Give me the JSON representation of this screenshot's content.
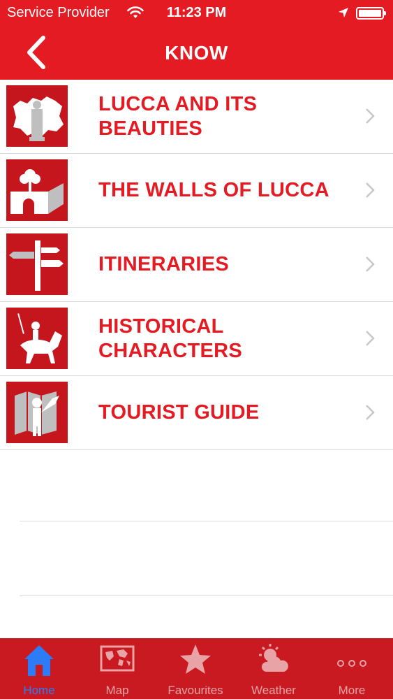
{
  "status_bar": {
    "carrier": "Service Provider",
    "time": "11:23 PM",
    "wifi_icon": "wifi-icon",
    "location_icon": "location-arrow-icon",
    "battery_icon": "battery-icon"
  },
  "nav": {
    "title": "KNOW",
    "back_icon": "chevron-left-icon"
  },
  "colors": {
    "brand_red": "#e41b23",
    "thumb_red": "#c4161c",
    "tabbar_red": "#c91a22",
    "active_tab": "#2b7cf6"
  },
  "list": {
    "items": [
      {
        "label": "LUCCA AND ITS BEAUTIES",
        "icon": "monuments-icon"
      },
      {
        "label": "THE WALLS OF LUCCA",
        "icon": "city-walls-icon"
      },
      {
        "label": "ITINERARIES",
        "icon": "signpost-icon"
      },
      {
        "label": "HISTORICAL CHARACTERS",
        "icon": "horseman-icon"
      },
      {
        "label": "TOURIST GUIDE",
        "icon": "tourist-map-icon"
      }
    ]
  },
  "tabbar": {
    "tabs": [
      {
        "label": "Home",
        "icon": "home-icon",
        "active": true
      },
      {
        "label": "Map",
        "icon": "world-map-icon",
        "active": false
      },
      {
        "label": "Favourites",
        "icon": "star-icon",
        "active": false
      },
      {
        "label": "Weather",
        "icon": "weather-icon",
        "active": false
      },
      {
        "label": "More",
        "icon": "more-dots-icon",
        "active": false
      }
    ]
  }
}
